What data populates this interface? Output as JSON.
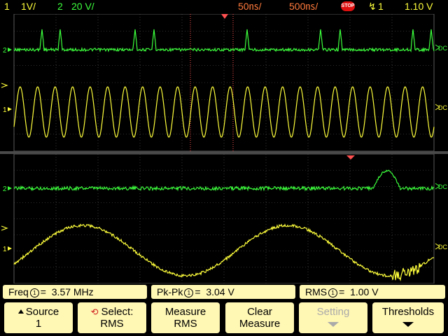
{
  "status": {
    "ch1_num": "1",
    "ch1_scale": "1V/",
    "ch2_num": "2",
    "ch2_scale": "20 V/",
    "timebase_main": "50㎱/",
    "timebase_delayed": "500㎱/",
    "run_state": "STOP",
    "trigger_source": "1",
    "trigger_level": "1.10 V"
  },
  "screen": {
    "channel_markers": [
      {
        "label": "2",
        "color": "#3cff3c"
      },
      {
        "label": "1",
        "color": "#ffff3c"
      },
      {
        "label": "2",
        "color": "#3cff3c"
      },
      {
        "label": "1",
        "color": "#ffff3c"
      }
    ],
    "coupling_labels": [
      "DC",
      "DC",
      "DC",
      "DC"
    ],
    "colors": {
      "channel1": "#ffff3c",
      "channel2": "#3cff3c",
      "delay_window": "#ff5050",
      "grid": "#5a5a5a"
    }
  },
  "measurements": [
    {
      "name": "Freq",
      "channel": "1",
      "value": "3.57 MHz"
    },
    {
      "name": "Pk-Pk",
      "channel": "1",
      "value": "3.04 V"
    },
    {
      "name": "RMS",
      "channel": "1",
      "value": "1.00 V"
    }
  ],
  "softkeys": {
    "source": {
      "line1": "Source",
      "line2": "1"
    },
    "select": {
      "line1": "Select:",
      "line2": "RMS"
    },
    "measure": {
      "line1": "Measure",
      "line2": "RMS"
    },
    "clear": {
      "line1": "Clear",
      "line2": "Measure"
    },
    "setting": {
      "line1": "Setting"
    },
    "thresholds": {
      "line1": "Thresholds"
    }
  }
}
